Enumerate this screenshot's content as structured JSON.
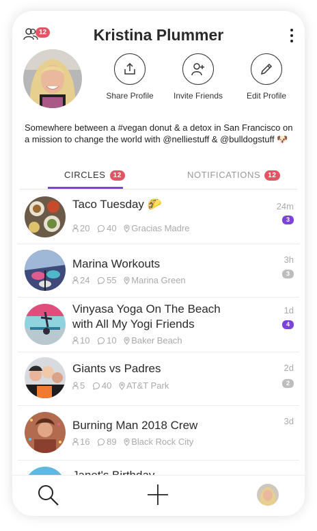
{
  "header": {
    "friends_badge": "12",
    "title": "Kristina Plummer"
  },
  "actions": [
    {
      "label": "Share Profile",
      "icon": "share-icon"
    },
    {
      "label": "Invite Friends",
      "icon": "add-person-icon"
    },
    {
      "label": "Edit Profile",
      "icon": "pencil-icon"
    }
  ],
  "bio": "Somewhere between a #vegan donut & a detox in San Francisco on a mission to change the world with @nelliestuff & @bulldogstuff 🐶",
  "tabs": [
    {
      "label": "CIRCLES",
      "badge": "12",
      "active": true
    },
    {
      "label": "NOTIFICATIONS",
      "badge": "12",
      "active": false
    }
  ],
  "circles": [
    {
      "title": "Taco Tuesday 🌮",
      "members": "20",
      "comments": "40",
      "location": "Gracias Madre",
      "time": "24m",
      "count": "3",
      "count_color": "purple"
    },
    {
      "title": "Marina Workouts",
      "members": "24",
      "comments": "55",
      "location": "Marina Green",
      "time": "3h",
      "count": "3",
      "count_color": "grey"
    },
    {
      "title": "Vinyasa Yoga On The Beach with All My Yogi Friends",
      "members": "10",
      "comments": "10",
      "location": "Baker Beach",
      "time": "1d",
      "count": "4",
      "count_color": "purple"
    },
    {
      "title": "Giants vs Padres",
      "members": "5",
      "comments": "40",
      "location": "AT&T Park",
      "time": "2d",
      "count": "2",
      "count_color": "grey"
    },
    {
      "title": "Burning Man 2018 Crew",
      "members": "16",
      "comments": "89",
      "location": "Black Rock City",
      "time": "3d",
      "count": "",
      "count_color": ""
    },
    {
      "title": "Janet's Birthday",
      "members": "",
      "comments": "",
      "location": "",
      "time": "",
      "count": "",
      "count_color": ""
    }
  ],
  "bottom_bar": {
    "icons": [
      "search-icon",
      "plus-icon",
      "avatar"
    ]
  },
  "colors": {
    "accent": "#7b43d6",
    "badge": "#e25563"
  }
}
